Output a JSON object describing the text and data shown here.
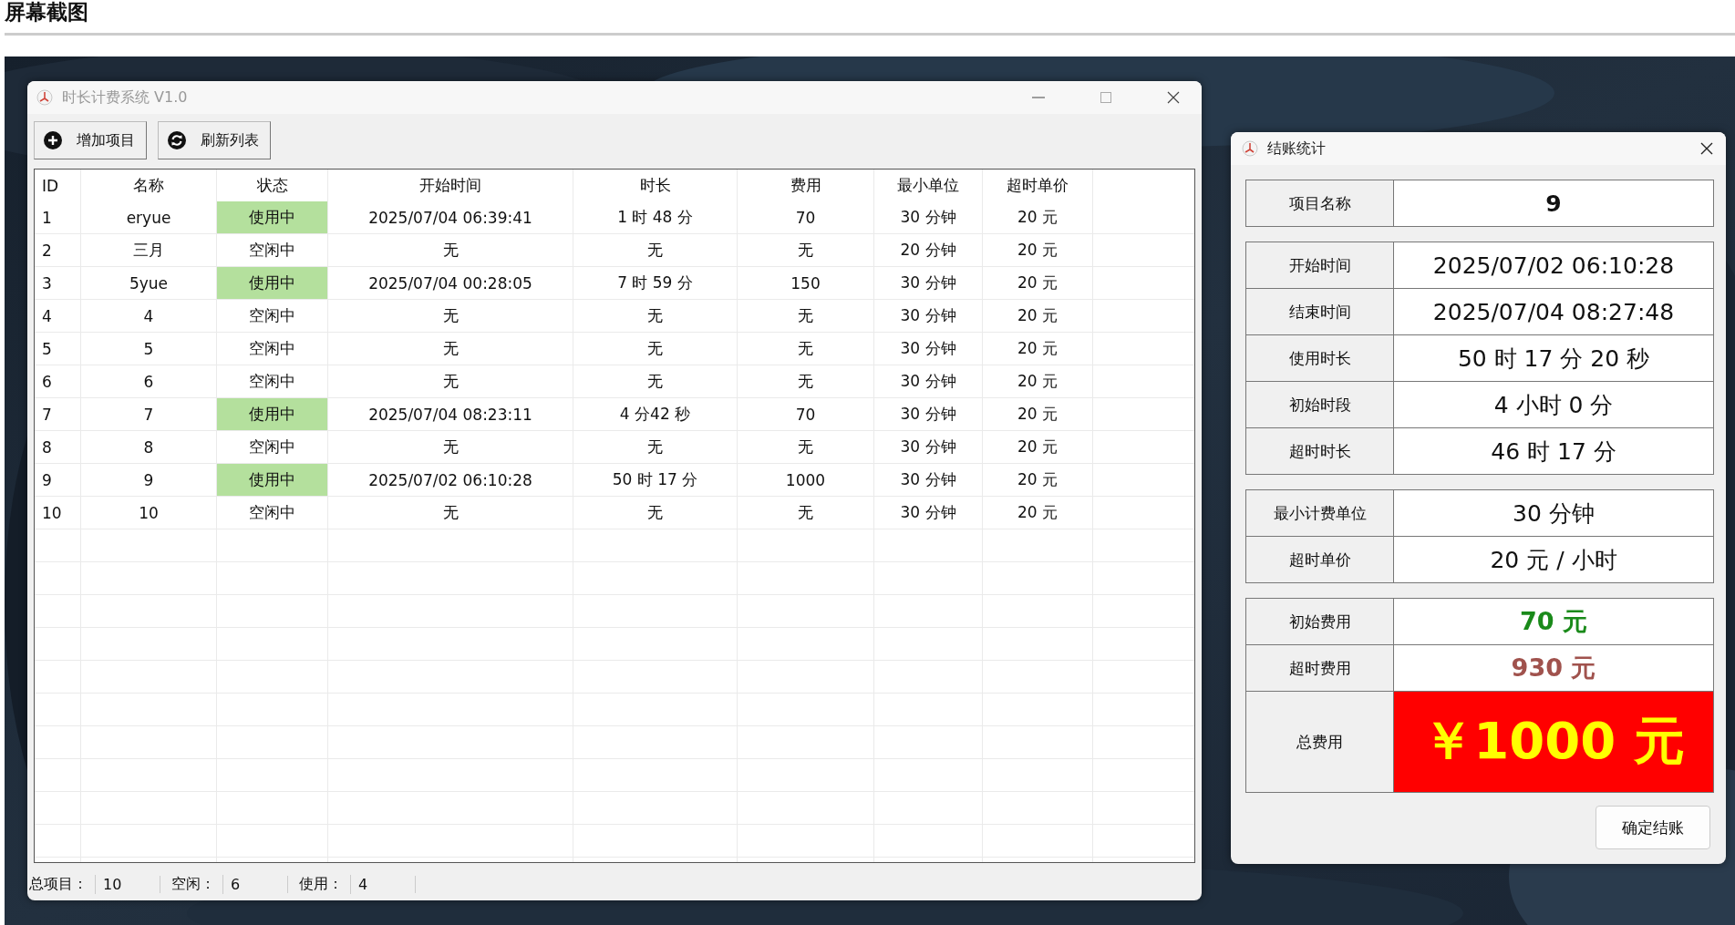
{
  "page": {
    "heading": "屏幕截图"
  },
  "main_window": {
    "title": "时长计费系统 V1.0",
    "toolbar": [
      {
        "label": "增加项目",
        "kind": "add"
      },
      {
        "label": "刷新列表",
        "kind": "refresh"
      }
    ],
    "table": {
      "columns": [
        "ID",
        "名称",
        "状态",
        "开始时间",
        "时长",
        "费用",
        "最小单位",
        "超时单价"
      ],
      "rows": [
        {
          "cells": [
            "1",
            "eryue",
            "使用中",
            "2025/07/04 06:39:41",
            "1 时 48 分",
            "70",
            "30 分钟",
            "20 元"
          ],
          "in_use": true
        },
        {
          "cells": [
            "2",
            "三月",
            "空闲中",
            "无",
            "无",
            "无",
            "20 分钟",
            "20 元"
          ],
          "in_use": false
        },
        {
          "cells": [
            "3",
            "5yue",
            "使用中",
            "2025/07/04 00:28:05",
            "7 时 59 分",
            "150",
            "30 分钟",
            "20 元"
          ],
          "in_use": true
        },
        {
          "cells": [
            "4",
            "4",
            "空闲中",
            "无",
            "无",
            "无",
            "30 分钟",
            "20 元"
          ],
          "in_use": false
        },
        {
          "cells": [
            "5",
            "5",
            "空闲中",
            "无",
            "无",
            "无",
            "30 分钟",
            "20 元"
          ],
          "in_use": false
        },
        {
          "cells": [
            "6",
            "6",
            "空闲中",
            "无",
            "无",
            "无",
            "30 分钟",
            "20 元"
          ],
          "in_use": false
        },
        {
          "cells": [
            "7",
            "7",
            "使用中",
            "2025/07/04 08:23:11",
            "4 分42 秒",
            "70",
            "30 分钟",
            "20 元"
          ],
          "in_use": true
        },
        {
          "cells": [
            "8",
            "8",
            "空闲中",
            "无",
            "无",
            "无",
            "30 分钟",
            "20 元"
          ],
          "in_use": false
        },
        {
          "cells": [
            "9",
            "9",
            "使用中",
            "2025/07/02 06:10:28",
            "50 时 17 分",
            "1000",
            "30 分钟",
            "20 元"
          ],
          "in_use": true
        },
        {
          "cells": [
            "10",
            "10",
            "空闲中",
            "无",
            "无",
            "无",
            "30 分钟",
            "20 元"
          ],
          "in_use": false
        }
      ]
    },
    "status_bar": [
      {
        "label": "总项目：",
        "value": "10"
      },
      {
        "label": "空闲：",
        "value": "6"
      },
      {
        "label": "使用：",
        "value": "4"
      }
    ]
  },
  "checkout_dialog": {
    "title": "结账统计",
    "groups": [
      [
        {
          "label": "项目名称",
          "value": "9",
          "kind": "bold"
        }
      ],
      [
        {
          "label": "开始时间",
          "value": "2025/07/02 06:10:28",
          "kind": "plain"
        },
        {
          "label": "结束时间",
          "value": "2025/07/04 08:27:48",
          "kind": "plain"
        },
        {
          "label": "使用时长",
          "value": "50 时 17 分 20 秒",
          "kind": "plain"
        },
        {
          "label": "初始时段",
          "value": "4 小时 0 分",
          "kind": "plain"
        },
        {
          "label": "超时时长",
          "value": "46 时 17 分",
          "kind": "plain"
        }
      ],
      [
        {
          "label": "最小计费单位",
          "value": "30 分钟",
          "kind": "plain"
        },
        {
          "label": "超时单价",
          "value": "20 元 / 小时",
          "kind": "plain"
        }
      ],
      [
        {
          "label": "初始费用",
          "value": "70 元",
          "kind": "fee",
          "color": "#1a8a1a"
        },
        {
          "label": "超时费用",
          "value": "930 元",
          "kind": "fee",
          "color": "#a0524d"
        },
        {
          "label": "总费用",
          "value": "￥1000 元",
          "kind": "total"
        }
      ]
    ],
    "button": "确定结账"
  }
}
